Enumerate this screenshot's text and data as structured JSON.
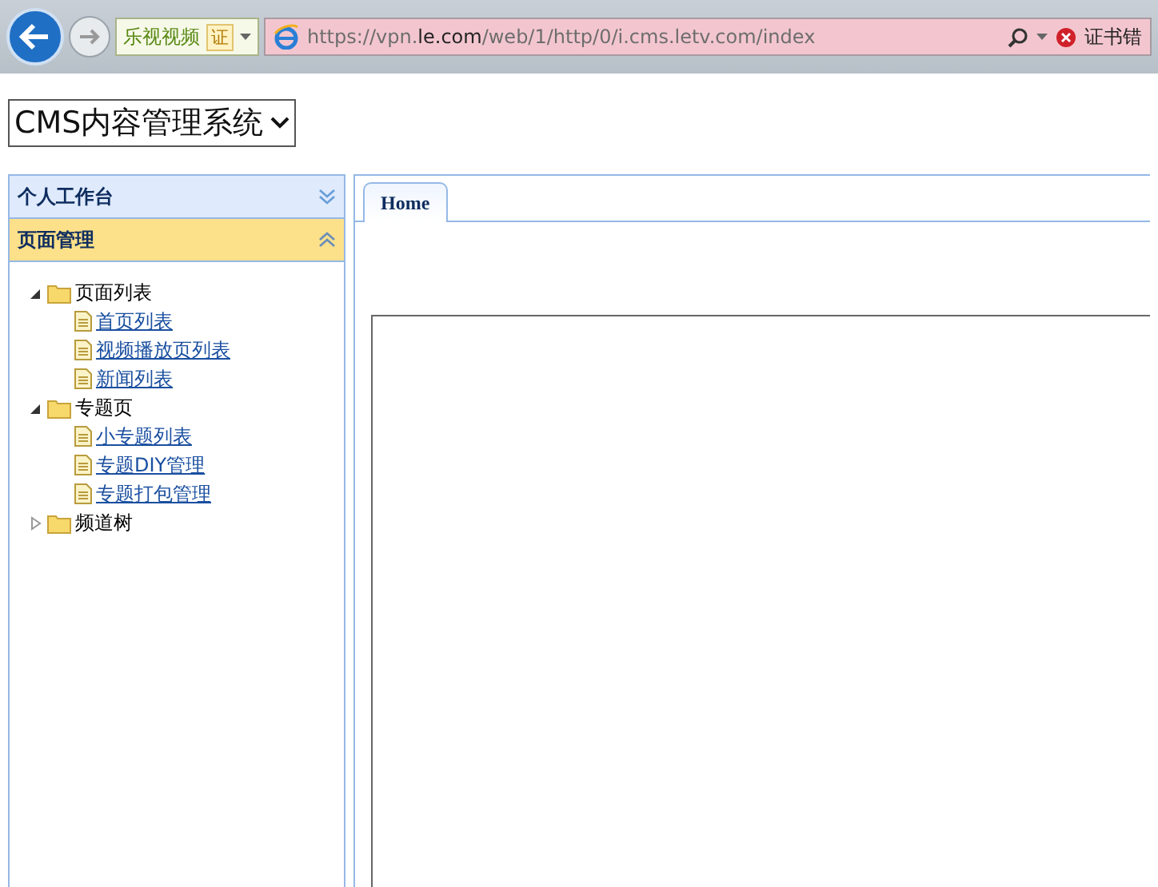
{
  "browser": {
    "favorite": {
      "label": "乐视视频",
      "badge": "证"
    },
    "url": {
      "prefix": "https://vpn.",
      "domain": "le.com",
      "path": "/web/1/http/0/i.cms.letv.com/index"
    },
    "cert_error": "证书错"
  },
  "system_select": {
    "value": "CMS内容管理系统"
  },
  "sidebar": {
    "panels": [
      {
        "title": "个人工作台",
        "expanded": false
      },
      {
        "title": "页面管理",
        "expanded": true
      }
    ],
    "tree": [
      {
        "label": "页面列表",
        "kind": "folder",
        "expanded": true,
        "children": [
          {
            "label": "首页列表",
            "kind": "page"
          },
          {
            "label": "视频播放页列表",
            "kind": "page"
          },
          {
            "label": "新闻列表",
            "kind": "page"
          }
        ]
      },
      {
        "label": "专题页",
        "kind": "folder",
        "expanded": true,
        "children": [
          {
            "label": "小专题列表",
            "kind": "page"
          },
          {
            "label": "专题DIY管理",
            "kind": "page"
          },
          {
            "label": "专题打包管理",
            "kind": "page"
          }
        ]
      },
      {
        "label": "频道树",
        "kind": "folder",
        "expanded": false
      }
    ]
  },
  "tabs": [
    {
      "label": "Home",
      "selected": true
    }
  ]
}
